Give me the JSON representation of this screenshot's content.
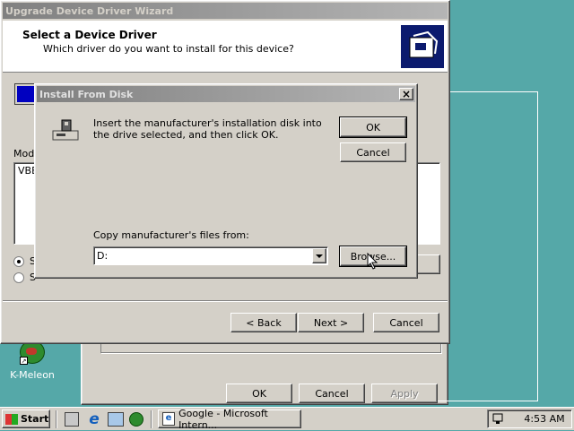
{
  "wizard": {
    "title": "Upgrade Device Driver Wizard",
    "heading": "Select a Device Driver",
    "subheading": "Which driver do you want to install for this device?",
    "models_label_partial": "Mode",
    "model_item_partial": "VBE",
    "radio1_partial": "S",
    "radio2_partial": "S",
    "back_label": "< Back",
    "next_label": "Next >",
    "cancel_label": "Cancel"
  },
  "dialog": {
    "title": "Install From Disk",
    "close_glyph": "×",
    "message": "Insert the manufacturer's installation disk into the drive selected, and then click OK.",
    "ok_label": "OK",
    "cancel_label": "Cancel",
    "copy_label": "Copy manufacturer's files from:",
    "path_value": "D:",
    "browse_label": "Browse..."
  },
  "back_window": {
    "ok_label": "OK",
    "cancel_label": "Cancel",
    "apply_label": "Apply"
  },
  "desktop": {
    "icon_label": "K-Meleon"
  },
  "taskbar": {
    "start_label": "Start",
    "task_label": "Google - Microsoft Intern...",
    "clock": "4:53 AM"
  }
}
